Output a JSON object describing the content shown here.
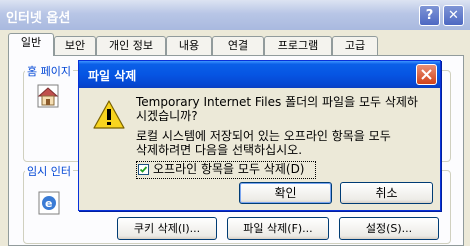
{
  "background_window": {
    "title": "인터넷 옵션",
    "tabs": [
      "일반",
      "보안",
      "개인 정보",
      "내용",
      "연결",
      "프로그램",
      "고급"
    ],
    "group_home": "홈 페이지",
    "group_temp": "임시 인터",
    "buttons": {
      "delete_cookies": "쿠키 삭제(I)...",
      "delete_files": "파일 삭제(F)...",
      "settings": "설정(S)..."
    }
  },
  "dialog": {
    "title": "파일 삭제",
    "message_line1": "Temporary Internet Files 폴더의 파일을 모두 삭제하",
    "message_line2": "시겠습니까?",
    "message_line3": "로컬 시스템에 저장되어 있는 오프라인 항목을 모두",
    "message_line4": "삭제하려면 다음을 선택하십시오.",
    "checkbox_label": "오프라인 항목을 모두 삭제(D)",
    "checkbox_checked": true,
    "ok_label": "확인",
    "cancel_label": "취소"
  },
  "colors": {
    "dialog_title_blue": "#0655e3",
    "close_red": "#d1431a",
    "window_face": "#ece9d8"
  }
}
